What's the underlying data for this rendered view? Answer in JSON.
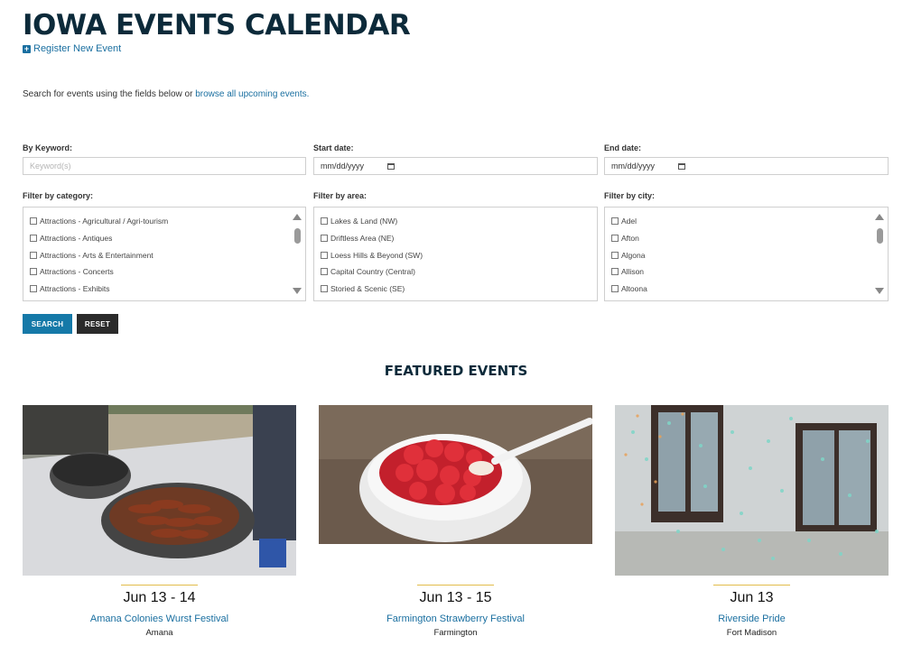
{
  "header": {
    "title": "IOWA EVENTS CALENDAR",
    "register_link": "Register New Event"
  },
  "intro": {
    "text": "Search for events using the fields below or ",
    "link": "browse all upcoming events."
  },
  "form": {
    "keyword": {
      "label": "By Keyword:",
      "placeholder": "Keyword(s)"
    },
    "start_date": {
      "label": "Start date:",
      "value": "mm/dd/yyyy"
    },
    "end_date": {
      "label": "End date:",
      "value": "mm/dd/yyyy"
    },
    "category": {
      "label": "Filter by category:",
      "options": [
        "Attractions - Agricultural / Agri-tourism",
        "Attractions - Antiques",
        "Attractions - Arts & Entertainment",
        "Attractions - Concerts",
        "Attractions - Exhibits"
      ]
    },
    "area": {
      "label": "Filter by area:",
      "options": [
        "Lakes & Land (NW)",
        "Driftless Area (NE)",
        "Loess Hills & Beyond (SW)",
        "Capital Country (Central)",
        "Storied & Scenic (SE)"
      ]
    },
    "city": {
      "label": "Filter by city:",
      "options": [
        "Adel",
        "Afton",
        "Algona",
        "Allison",
        "Altoona"
      ]
    },
    "search_button": "SEARCH",
    "reset_button": "RESET"
  },
  "featured": {
    "heading": "FEATURED EVENTS",
    "events": [
      {
        "date": "Jun 13 - 14",
        "name": "Amana Colonies Wurst Festival",
        "city": "Amana"
      },
      {
        "date": "Jun 13 - 15",
        "name": "Farmington Strawberry Festival",
        "city": "Farmington"
      },
      {
        "date": "Jun 13",
        "name": "Riverside Pride",
        "city": "Fort Madison"
      }
    ]
  },
  "colors": {
    "title": "#0c2a3a",
    "link": "#1a6fa0",
    "search_button": "#1579a8",
    "reset_button": "#2b2b2b",
    "separator": "#e2bc4b"
  }
}
